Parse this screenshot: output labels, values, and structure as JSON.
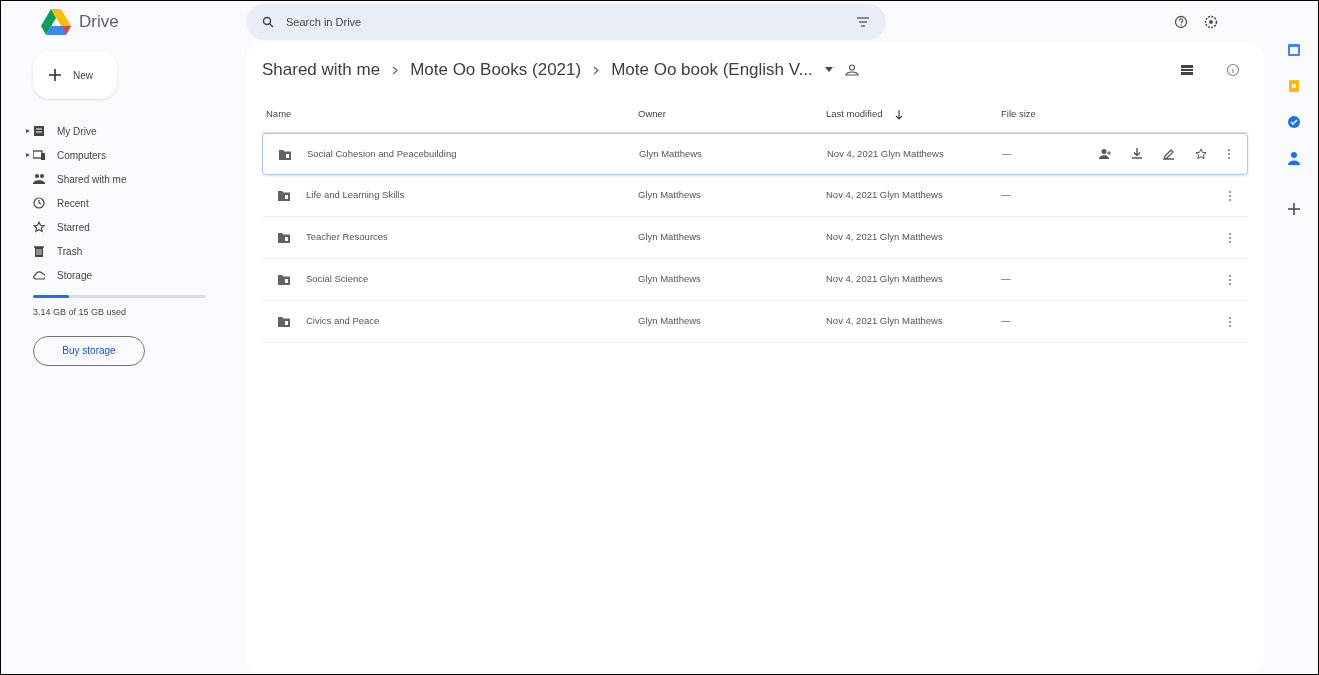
{
  "app": {
    "title": "Drive"
  },
  "search": {
    "placeholder": "Search in Drive"
  },
  "new_button": {
    "label": "New"
  },
  "sidebar": {
    "items": [
      {
        "label": "My Drive",
        "expandable": true
      },
      {
        "label": "Computers",
        "expandable": true
      },
      {
        "label": "Shared with me",
        "expandable": false
      },
      {
        "label": "Recent",
        "expandable": false
      },
      {
        "label": "Starred",
        "expandable": false
      },
      {
        "label": "Trash",
        "expandable": false
      },
      {
        "label": "Storage",
        "expandable": false
      }
    ]
  },
  "storage": {
    "level": 0.21,
    "text": "3.14 GB of 15 GB used",
    "button": "Buy storage"
  },
  "breadcrumb": [
    "Shared with me",
    "Mote Oo Books (2021)",
    "Mote Oo book (English V..."
  ],
  "table": {
    "columns": [
      "Name",
      "Owner",
      "Last modified",
      "File size"
    ],
    "rows": [
      {
        "name": "Social Cohesion and Peacebuilding",
        "owner": "Glyn Matthews",
        "modified": "Nov 4, 2021 Glyn Matthews",
        "size": "—",
        "selected": true
      },
      {
        "name": "Life and Learning Skills",
        "owner": "Glyn Matthews",
        "modified": "Nov 4, 2021 Glyn Matthews",
        "size": "—",
        "selected": false
      },
      {
        "name": "Teacher Resources",
        "owner": "Glyn Matthews",
        "modified": "Nov 4, 2021 Glyn Matthews",
        "selected": false
      },
      {
        "name": "Social Science",
        "owner": "Glyn Matthews",
        "modified": "Nov 4, 2021 Glyn Matthews",
        "size": "—",
        "selected": false
      },
      {
        "name": "Civics and Peace",
        "owner": "Glyn Matthews",
        "modified": "Nov 4, 2021 Glyn Matthews",
        "size": "—",
        "selected": false
      }
    ]
  }
}
